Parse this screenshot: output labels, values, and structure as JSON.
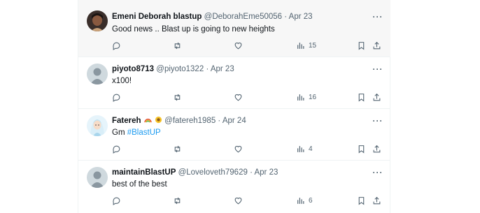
{
  "tweets": [
    {
      "name": "Emeni Deborah blastup",
      "handle": "@DeborahEme50056",
      "date": "Apr 23",
      "text": "Good news .. Blast up is going to new heights",
      "views": "15",
      "avatar": "photo-avatar",
      "highlighted": true
    },
    {
      "name": "piyoto8713",
      "handle": "@piyoto1322",
      "date": "Apr 23",
      "text": "x100!",
      "views": "16",
      "avatar": "default-avatar",
      "highlighted": false
    },
    {
      "name": "Fatereh",
      "name_emojis": [
        "rainbow-emoji",
        "sunflower-emoji"
      ],
      "handle": "@fatereh1985",
      "date": "Apr 24",
      "text": "Gm ",
      "hashtag": "#BlastUP",
      "views": "4",
      "avatar": "illustrated-avatar",
      "highlighted": false
    },
    {
      "name": "maintainBlastUP",
      "handle": "@Loveloveth79629",
      "date": "Apr 23",
      "text": "best of the best",
      "views": "6",
      "avatar": "default-avatar",
      "highlighted": false
    }
  ],
  "separator": "·",
  "more_label": "···",
  "colors": {
    "secondary_text": "#536471",
    "link": "#1d9bf0",
    "border": "#eff3f4",
    "highlight_bg": "#f7f7f7"
  }
}
